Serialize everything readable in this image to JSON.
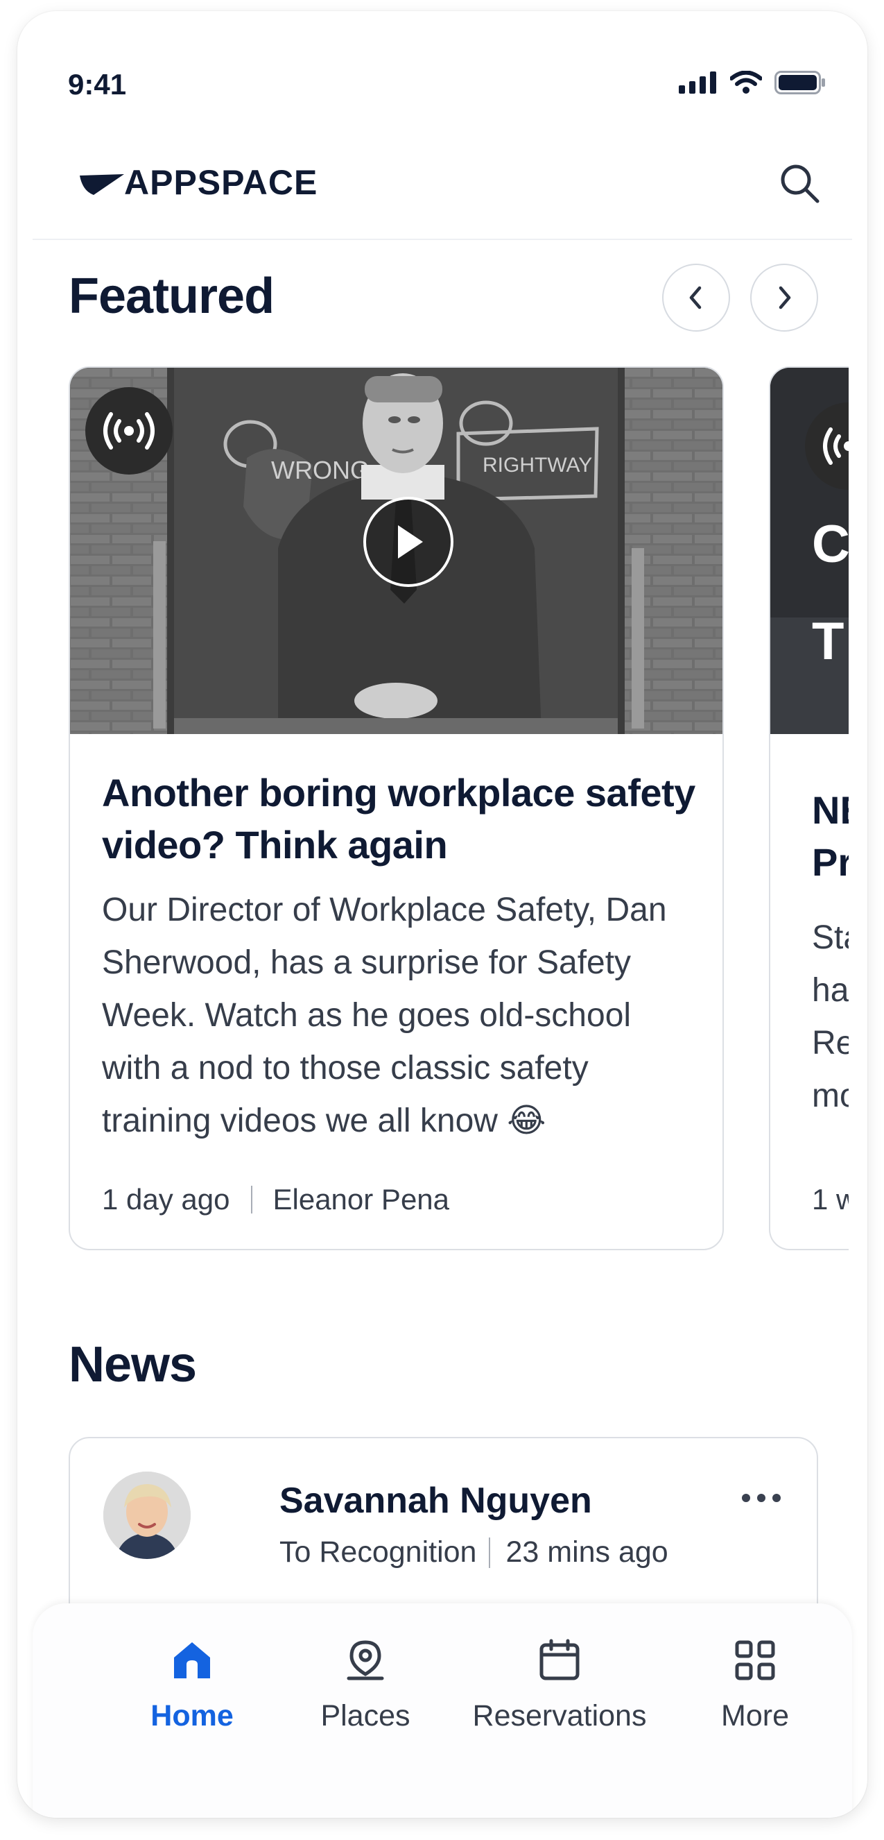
{
  "status_bar": {
    "time": "9:41"
  },
  "header": {
    "logo_text": "APPSPACE"
  },
  "featured": {
    "title": "Featured",
    "cards": [
      {
        "title": "Another boring workplace safety video? Think again",
        "description": "Our Director of Workplace Safety, Dan Sherwood, has a surprise for Safety Week. Watch as he goes old-school with a nod to those classic safety training videos we all know 😂",
        "time": "1 day ago",
        "author": "Eleanor Pena",
        "chalkboard_left": "WRONG",
        "chalkboard_right": "RIGHTWAY"
      },
      {
        "overlay_lines": [
          "C",
          "T"
        ],
        "title_lines": [
          "NE",
          "Pr"
        ],
        "description_lines": [
          "Sta",
          "ha",
          "Re",
          "mo"
        ],
        "meta": "1 w"
      }
    ]
  },
  "news": {
    "title": "News",
    "items": [
      {
        "author": "Savannah Nguyen",
        "channel": "To Recognition",
        "time": "23 mins ago"
      }
    ]
  },
  "tabbar": {
    "tabs": [
      {
        "label": "Home",
        "icon": "home-icon",
        "active": true
      },
      {
        "label": "Places",
        "icon": "location-pin-icon",
        "active": false
      },
      {
        "label": "Reservations",
        "icon": "calendar-icon",
        "active": false
      },
      {
        "label": "More",
        "icon": "grid-icon",
        "active": false
      }
    ]
  },
  "colors": {
    "accent": "#1463e0",
    "text_dark": "#0f1a33",
    "text_muted": "#363d4a",
    "border": "#dcdfe4"
  }
}
